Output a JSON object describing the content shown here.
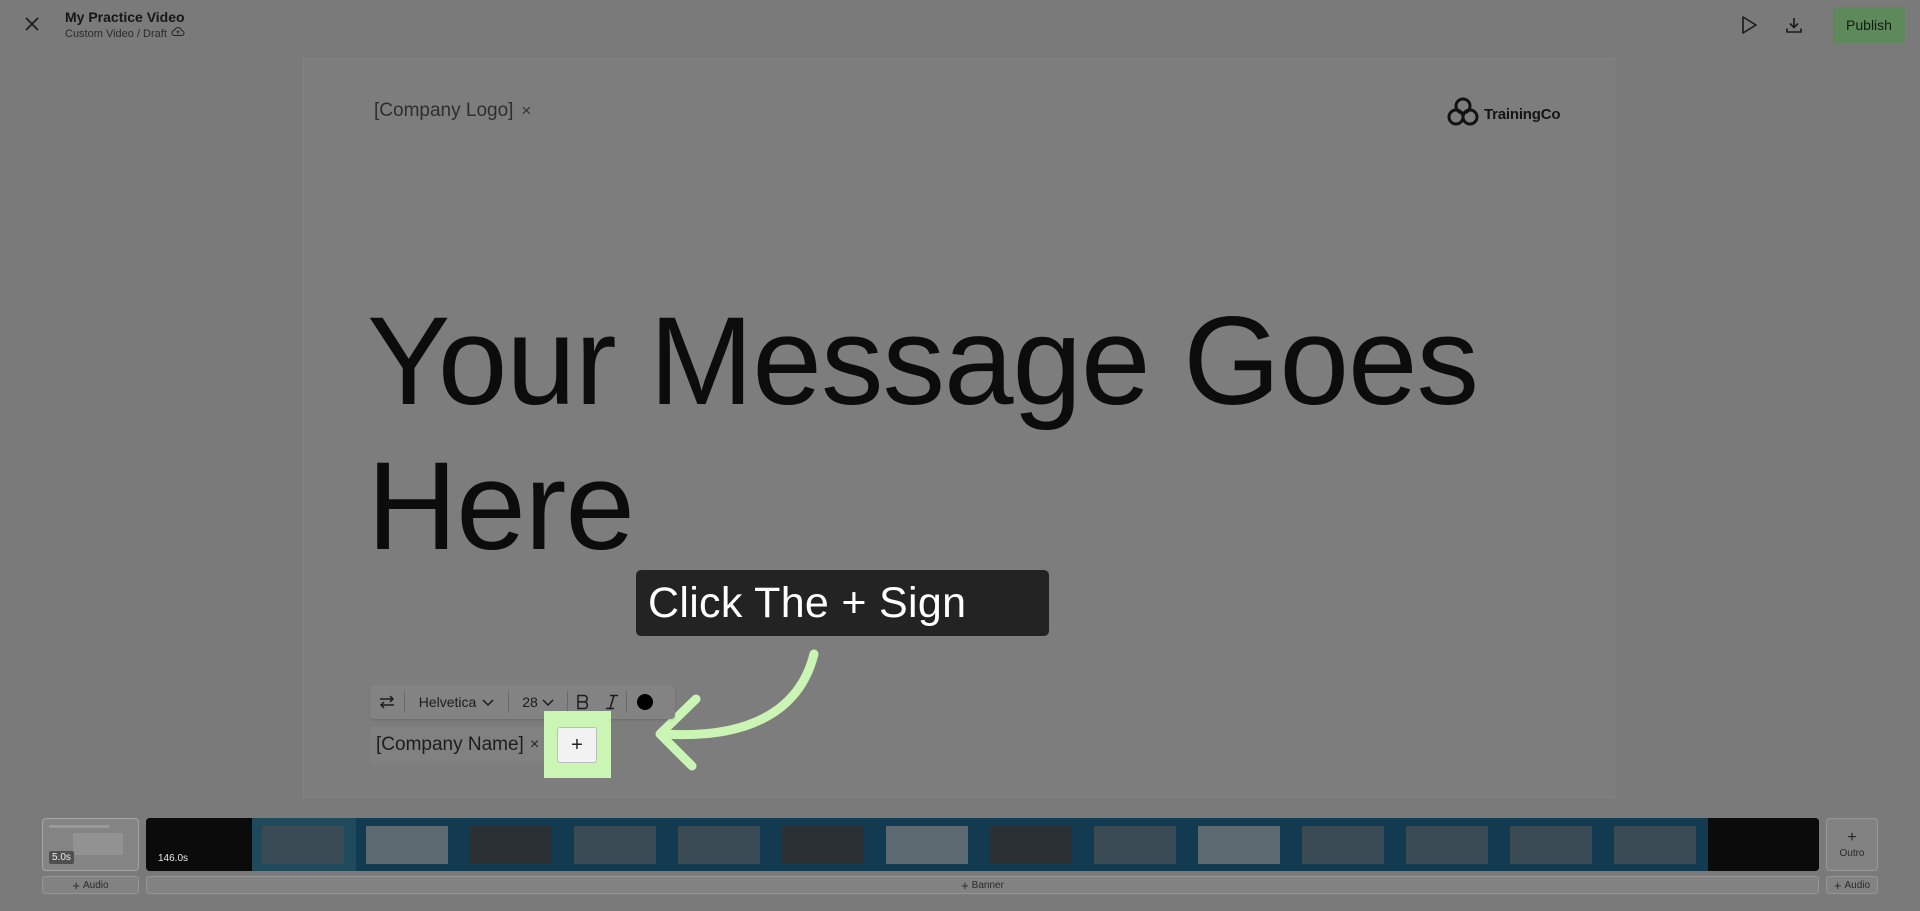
{
  "header": {
    "title": "My Practice Video",
    "subtitle": "Custom Video / Draft",
    "publish_label": "Publish"
  },
  "canvas": {
    "logo_placeholder": "[Company Logo]",
    "remove_symbol": "×",
    "brand_name": "TrainingCo",
    "headline_line1": "Your Message Goes",
    "headline_line2": "Here",
    "company_placeholder": "[Company Name]"
  },
  "toolbar": {
    "font_family": "Helvetica",
    "font_size": "28",
    "bold_label": "B",
    "italic_label": "I",
    "color": "#000000"
  },
  "tutorial": {
    "callout_text": "Click The + Sign",
    "highlight_color": "#caf5b5"
  },
  "plus_button_label": "+",
  "timeline": {
    "intro_duration": "5.0s",
    "main_duration": "146.0s",
    "outro_label": "Outro",
    "add_audio_label": "Audio",
    "add_banner_label": "Banner",
    "add_symbol": "+"
  },
  "colors": {
    "publish_bg": "#5e8a5b",
    "callout_bg": "#232323",
    "arrow": "#caf5b5"
  }
}
